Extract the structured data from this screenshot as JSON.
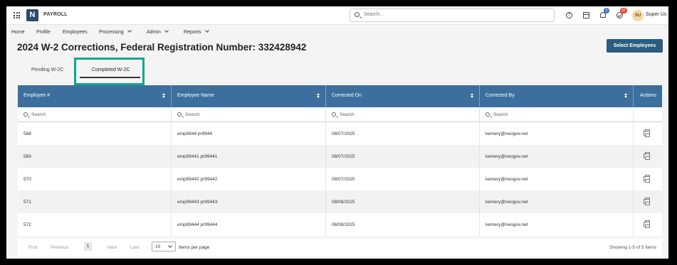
{
  "app": {
    "logo_letter": "N",
    "name": "PAYROLL"
  },
  "search": {
    "placeholder": "Search..."
  },
  "topbar": {
    "help": "?",
    "bell_badge": "3",
    "check_badge": "32",
    "avatar_initials": "SU",
    "username": "Super Us"
  },
  "nav": {
    "items": [
      {
        "label": "Home"
      },
      {
        "label": "Profile"
      },
      {
        "label": "Employees"
      },
      {
        "label": "Processing"
      },
      {
        "label": "Admin"
      },
      {
        "label": "Reports"
      }
    ]
  },
  "page": {
    "title": "2024 W-2 Corrections, Federal Registration Number: 332428942",
    "primary_button": "Select Employees"
  },
  "tabs": [
    {
      "label": "Pending W-2C",
      "active": false
    },
    {
      "label": "Completed W-2C",
      "active": true
    }
  ],
  "table": {
    "columns": [
      "Employee #",
      "Employee Name",
      "Corrected On",
      "Corrected By",
      "Actions"
    ],
    "filter_placeholder": "Search",
    "rows": [
      {
        "employee_no": "568",
        "name": "emp9944 pr9944",
        "corrected_on": "08/07/2025",
        "corrected_by": "kemery@neogov.net"
      },
      {
        "employee_no": "569",
        "name": "emp99441 pr99441",
        "corrected_on": "08/07/2025",
        "corrected_by": "kemery@neogov.net"
      },
      {
        "employee_no": "570",
        "name": "emp99442 pr99442",
        "corrected_on": "08/07/2025",
        "corrected_by": "kemery@neogov.net"
      },
      {
        "employee_no": "571",
        "name": "emp99443 pr99443",
        "corrected_on": "08/08/2025",
        "corrected_by": "kemery@neogov.net"
      },
      {
        "employee_no": "572",
        "name": "emp99444 pr99444",
        "corrected_on": "08/08/2025",
        "corrected_by": "kemery@neogov.net"
      }
    ]
  },
  "pagination": {
    "first": "First",
    "previous": "Previous",
    "current_page": "1",
    "next": "Next",
    "last": "Last",
    "per_page_value": "10",
    "per_page_label": "Items per page",
    "showing": "Showing 1-5 of 5 items"
  },
  "colors": {
    "header_blue": "#3c6f9e",
    "button_blue": "#2c5c7f",
    "highlight_green": "#13a58d"
  }
}
